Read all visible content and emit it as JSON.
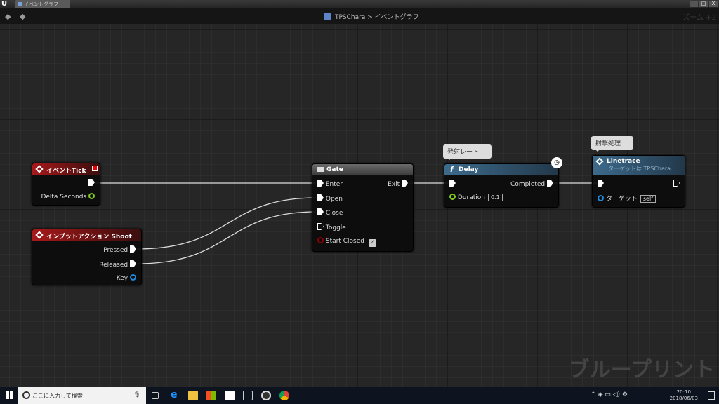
{
  "window": {
    "tab_title": "イベントグラフ",
    "controls": [
      "_",
      "□",
      "X"
    ]
  },
  "toolbar": {
    "breadcrumb_root": "TPSChara",
    "breadcrumb_sep": ">",
    "breadcrumb_leaf": "イベントグラフ",
    "zoom": "ズーム +2"
  },
  "nodes": {
    "event_tick": {
      "title": "イベントTick",
      "pins": {
        "delta": "Delta Seconds"
      }
    },
    "input_action": {
      "title": "インプットアクション Shoot",
      "pins": {
        "pressed": "Pressed",
        "released": "Released",
        "key": "Key"
      }
    },
    "gate": {
      "title": "Gate",
      "pins": {
        "enter": "Enter",
        "open": "Open",
        "close": "Close",
        "toggle": "Toggle",
        "start_closed": "Start Closed",
        "exit": "Exit"
      },
      "start_closed_checked": true
    },
    "delay": {
      "title": "Delay",
      "comment": "発射レート",
      "pins": {
        "completed": "Completed",
        "duration": "Duration"
      },
      "duration_value": "0.1"
    },
    "linetrace": {
      "title": "Linetrace",
      "subtitle": "ターゲットは TPSChara",
      "comment": "射撃処理",
      "pins": {
        "target": "ターゲット"
      },
      "target_value": "self"
    }
  },
  "watermark": "ブループリント",
  "taskbar": {
    "search_placeholder": "ここに入力して検索",
    "time": "20:10",
    "date": "2018/06/03"
  },
  "colors": {
    "event_header": "#a8191b",
    "function_header": "#3d6b8c",
    "float_pin": "#7ecb20",
    "object_pin": "#1e8ae0",
    "bool_pin": "#8a0000"
  }
}
